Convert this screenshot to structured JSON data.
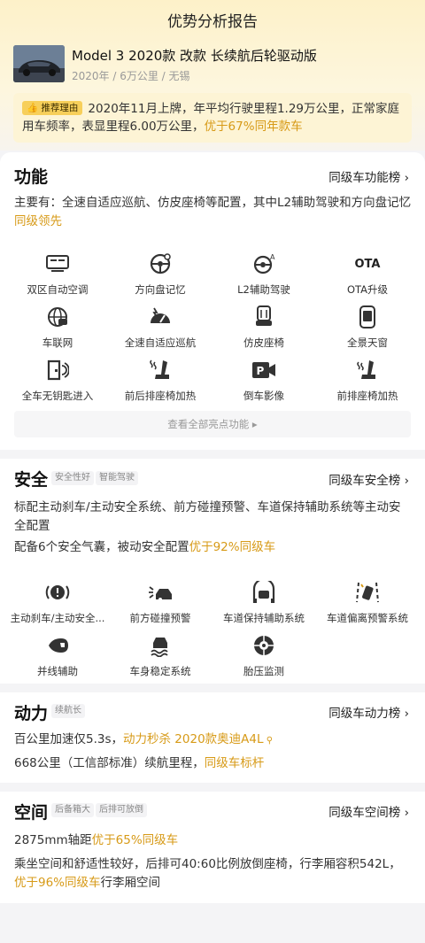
{
  "page": {
    "title": "优势分析报告"
  },
  "car": {
    "name": "Model 3 2020款 改款 长续航后轮驱动版",
    "meta": "2020年 / 6万公里 / 无锡"
  },
  "reason": {
    "badge": "推荐理由",
    "text_before": "2020年11月上牌，年平均行驶里程1.29万公里，正常家庭用车频率，表显里程6.00万公里，",
    "highlight": "优于67%同年款车"
  },
  "features": {
    "title": "功能",
    "rank_link": "同级车功能榜 ›",
    "desc_before": "主要有：全速自适应巡航、仿皮座椅等配置，其中L2辅助驾驶和方向盘记忆",
    "desc_highlight": "同级领先",
    "items": [
      {
        "label": "双区自动空调",
        "icon": "dual-zone-ac-icon"
      },
      {
        "label": "方向盘记忆",
        "icon": "steering-memory-icon"
      },
      {
        "label": "L2辅助驾驶",
        "icon": "l2-assist-driving-icon"
      },
      {
        "label": "OTA升级",
        "icon": "ota-upgrade-icon",
        "icon_text": "OTA"
      },
      {
        "label": "车联网",
        "icon": "connected-car-icon"
      },
      {
        "label": "全速自适应巡航",
        "icon": "adaptive-cruise-icon"
      },
      {
        "label": "仿皮座椅",
        "icon": "leatherette-seat-icon"
      },
      {
        "label": "全景天窗",
        "icon": "panoramic-sunroof-icon"
      },
      {
        "label": "全车无钥匙进入",
        "icon": "keyless-entry-icon"
      },
      {
        "label": "前后排座椅加热",
        "icon": "front-rear-seat-heating-icon"
      },
      {
        "label": "倒车影像",
        "icon": "reverse-camera-icon"
      },
      {
        "label": "前排座椅加热",
        "icon": "front-seat-heating-icon"
      }
    ],
    "view_all": "查看全部亮点功能 ▸"
  },
  "safety": {
    "title": "安全",
    "tags": [
      "安全性好",
      "智能驾驶"
    ],
    "rank_link": "同级车安全榜 ›",
    "desc1": "标配主动刹车/主动安全系统、前方碰撞预警、车道保持辅助系统等主动安全配置",
    "desc2_before": "配备6个安全气囊，被动安全配置",
    "desc2_highlight": "优于92%同级车",
    "items": [
      {
        "label": "主动刹车/主动安全...",
        "icon": "active-brake-icon"
      },
      {
        "label": "前方碰撞预警",
        "icon": "forward-collision-warning-icon"
      },
      {
        "label": "车道保持辅助系统",
        "icon": "lane-keep-assist-icon"
      },
      {
        "label": "车道偏离预警系统",
        "icon": "lane-departure-warning-icon"
      },
      {
        "label": "并线辅助",
        "icon": "blind-spot-assist-icon"
      },
      {
        "label": "车身稳定系统",
        "icon": "stability-control-icon"
      },
      {
        "label": "胎压监测",
        "icon": "tire-pressure-icon"
      }
    ]
  },
  "power": {
    "title": "动力",
    "tags": [
      "续航长"
    ],
    "rank_link": "同级车动力榜 ›",
    "line1_before": "百公里加速仅5.3s，",
    "line1_highlight": "动力秒杀 2020款奥迪A4L",
    "line2_before": "668公里（工信部标准）续航里程，",
    "line2_highlight": "同级车标杆"
  },
  "space": {
    "title": "空间",
    "tags": [
      "后备箱大",
      "后排可放倒"
    ],
    "rank_link": "同级车空间榜 ›",
    "line1_before": "2875mm轴距",
    "line1_highlight": "优于65%同级车",
    "line2_before": "乘坐空间和舒适性较好，后排可40:60比例放倒座椅，行李厢容积542L，",
    "line2_highlight": "优于96%同级车",
    "line2_after": "行李厢空间"
  },
  "colors": {
    "accent": "#d79a17",
    "badge": "#f7cf5a",
    "header_bg": "#fdf1c9"
  }
}
